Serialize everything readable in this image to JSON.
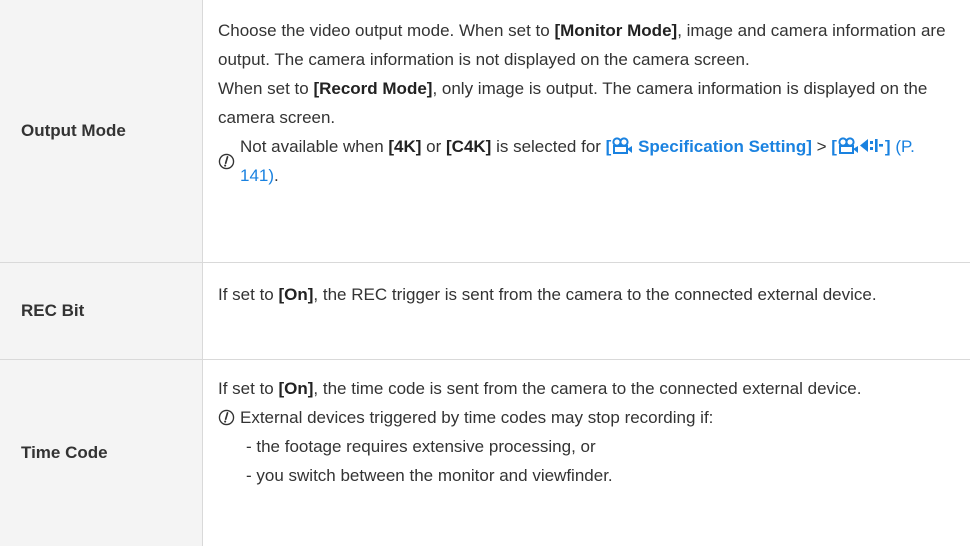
{
  "rows": [
    {
      "label": "Output Mode",
      "p1_a": "Choose the video output mode. When set to ",
      "p1_b": "[Monitor Mode]",
      "p1_c": ", image and camera information are output. The camera information is not displayed on the camera screen.",
      "p2_a": "When set to ",
      "p2_b": "[Record Mode]",
      "p2_c": ", only image is output. The camera information is displayed on the camera screen.",
      "note_a": "Not available when ",
      "note_b": "[4K]",
      "note_c": " or ",
      "note_d": "[C4K]",
      "note_e": " is selected for ",
      "note_f": "[",
      "note_g": " Specification Setting]",
      "note_h": " > ",
      "note_i": "[",
      "note_j": "]",
      "note_k": " (P. 141)",
      "note_l": "."
    },
    {
      "label": "REC Bit",
      "p1_a": "If set to ",
      "p1_b": "[On]",
      "p1_c": ", the REC trigger is sent from the camera to the connected external device."
    },
    {
      "label": "Time Code",
      "p1_a": "If set to ",
      "p1_b": "[On]",
      "p1_c": ", the time code is sent from the camera to the connected external device.",
      "note": "External devices triggered by time codes may stop recording if:",
      "bullets": [
        "- the footage requires extensive processing, or",
        "- you switch between the monitor and viewfinder."
      ]
    }
  ],
  "icons": {
    "note": "caution-icon",
    "movie": "movie-mode-icon",
    "bitrate": "bitrate-icon"
  },
  "colors": {
    "link": "#1a82e0",
    "label_bg": "#f4f4f4",
    "border": "#d9d9d9"
  }
}
